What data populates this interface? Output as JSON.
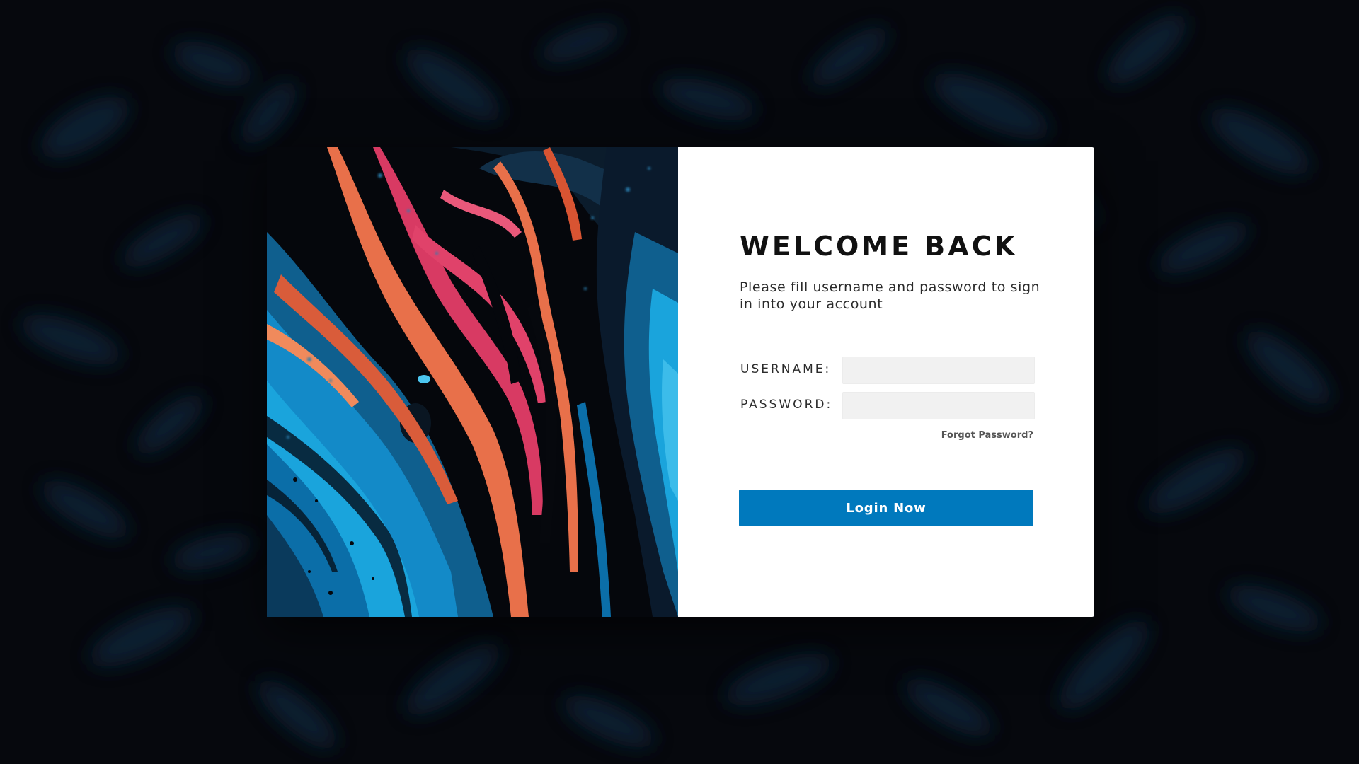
{
  "login": {
    "title": "WELCOME BACK",
    "subtitle": "Please fill username and password to sign in into your account",
    "username_label": "USERNAME:",
    "username_value": "",
    "password_label": "PASSWORD:",
    "password_value": "",
    "forgot_link": "Forgot Password?",
    "submit_label": "Login Now"
  },
  "colors": {
    "page_background": "#06080d",
    "panel_background": "#ffffff",
    "input_background": "#f1f1f1",
    "button_background": "#0079bd",
    "art_orange": "#e8704a",
    "art_pink": "#d83a63",
    "art_blue": "#138ac8"
  }
}
